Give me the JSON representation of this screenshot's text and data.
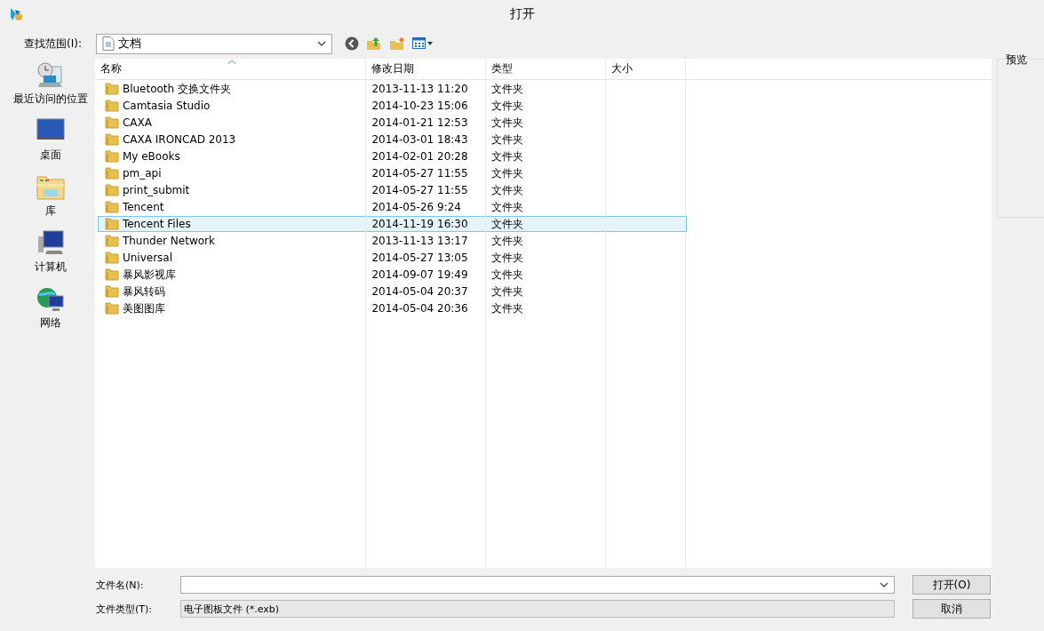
{
  "window": {
    "title": "打开"
  },
  "look_in": {
    "label": "查找范围(I):",
    "value": "文档"
  },
  "places": [
    {
      "label": "最近访问的位置",
      "kind": "recent"
    },
    {
      "label": "桌面",
      "kind": "desktop"
    },
    {
      "label": "库",
      "kind": "library"
    },
    {
      "label": "计算机",
      "kind": "computer"
    },
    {
      "label": "网络",
      "kind": "network"
    }
  ],
  "table": {
    "columns": [
      "名称",
      "修改日期",
      "类型",
      "大小"
    ],
    "rows": [
      {
        "name": "Bluetooth 交换文件夹",
        "modified": "2013-11-13 11:20",
        "type": "文件夹",
        "selected": false
      },
      {
        "name": "Camtasia Studio",
        "modified": "2014-10-23 15:06",
        "type": "文件夹",
        "selected": false
      },
      {
        "name": "CAXA",
        "modified": "2014-01-21 12:53",
        "type": "文件夹",
        "selected": false
      },
      {
        "name": "CAXA IRONCAD 2013",
        "modified": "2014-03-01 18:43",
        "type": "文件夹",
        "selected": false
      },
      {
        "name": "My eBooks",
        "modified": "2014-02-01 20:28",
        "type": "文件夹",
        "selected": false
      },
      {
        "name": "pm_api",
        "modified": "2014-05-27 11:55",
        "type": "文件夹",
        "selected": false
      },
      {
        "name": "print_submit",
        "modified": "2014-05-27 11:55",
        "type": "文件夹",
        "selected": false
      },
      {
        "name": "Tencent",
        "modified": "2014-05-26 9:24",
        "type": "文件夹",
        "selected": false
      },
      {
        "name": "Tencent Files",
        "modified": "2014-11-19 16:30",
        "type": "文件夹",
        "selected": true
      },
      {
        "name": "Thunder Network",
        "modified": "2013-11-13 13:17",
        "type": "文件夹",
        "selected": false
      },
      {
        "name": "Universal",
        "modified": "2014-05-27 13:05",
        "type": "文件夹",
        "selected": false
      },
      {
        "name": "暴风影视库",
        "modified": "2014-09-07 19:49",
        "type": "文件夹",
        "selected": false
      },
      {
        "name": "暴风转码",
        "modified": "2014-05-04 20:37",
        "type": "文件夹",
        "selected": false
      },
      {
        "name": "美图图库",
        "modified": "2014-05-04 20:36",
        "type": "文件夹",
        "selected": false
      }
    ]
  },
  "preview": {
    "label": "预览"
  },
  "file_name": {
    "label": "文件名(N):"
  },
  "file_type": {
    "label": "文件类型(T):",
    "value": "电子图板文件 (*.exb)"
  },
  "buttons": [
    "打开(O)",
    "取消"
  ]
}
